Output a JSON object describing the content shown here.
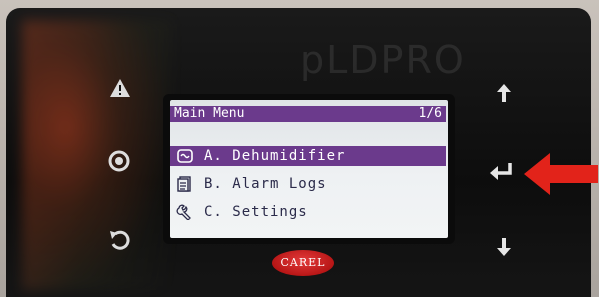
{
  "screen": {
    "title": "Main Menu",
    "page": "1/6",
    "items": [
      {
        "label": "A. Dehumidifier",
        "icon": "dehumidifier-icon",
        "selected": true
      },
      {
        "label": "B. Alarm Logs",
        "icon": "alarm-log-icon",
        "selected": false
      },
      {
        "label": "C. Settings",
        "icon": "wrench-icon",
        "selected": false
      }
    ]
  },
  "device": {
    "brand_watermark": "pLDPRO",
    "logo_text": "CAREL"
  },
  "buttons": {
    "left": [
      "alarm-button",
      "program-button",
      "escape-button"
    ],
    "right": [
      "up-button",
      "enter-button",
      "down-button"
    ]
  },
  "colors": {
    "selection": "#6b3a8c",
    "lcd_background": "#eef1f3",
    "annotation_arrow": "#e2231a"
  }
}
